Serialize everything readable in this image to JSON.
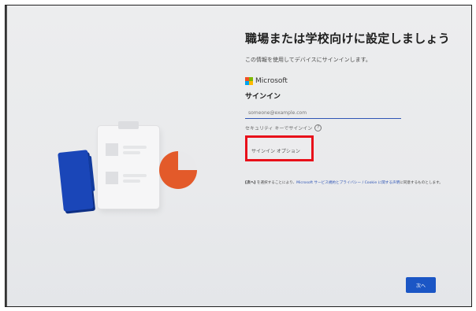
{
  "title": "職場または学校向けに設定しましょう",
  "subtitle": "この情報を使用してデバイスにサインインします。",
  "brand": {
    "name": "Microsoft"
  },
  "signin": {
    "heading": "サインイン",
    "email_placeholder": "someone@example.com",
    "security_key_text": "セキュリティ キーでサインイン",
    "help_glyph": "?",
    "options_link": "サインイン オプション"
  },
  "legal": {
    "bold": "[次へ]",
    "text_1": " を選択することにより、",
    "link": "Microsoft サービス規約とプライバシー / Cookie に関する声明",
    "text_2": "に同意するものとします。"
  },
  "next_button": "次へ",
  "colors": {
    "accent": "#1b56c5",
    "highlight_box": "#e8101a",
    "folder_blue": "#1a46b8",
    "pie_orange": "#e35a2a"
  }
}
